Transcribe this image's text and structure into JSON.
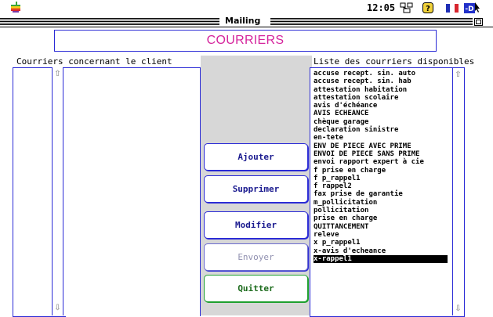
{
  "menubar": {
    "apple_icon": "apple-logo-icon",
    "clock": "12:05",
    "icons": [
      "application-icon",
      "help-icon",
      "flag-icon",
      "keyboard-icon"
    ]
  },
  "window": {
    "title": "Mailing"
  },
  "header": {
    "title": "COURRIERS"
  },
  "left_panel": {
    "label": "Courriers concernant le client",
    "items": []
  },
  "right_panel": {
    "label": "Liste des courriers disponibles",
    "items": [
      "accuse recept. sin. auto",
      "accuse recept. sin. hab",
      "attestation habitation",
      "attestation scolaire",
      "avis d'échéance",
      "AVIS ECHEANCE",
      "chèque garage",
      "declaration sinistre",
      "en-tete",
      "ENV DE PIECE AVEC PRIME",
      "ENVOI DE PIECE SANS PRIME",
      "envoi rapport expert à cie",
      "f prise en charge",
      "f p_rappel1",
      "f rappel2",
      "fax prise de garantie",
      "m_pollicitation",
      "pollicitation",
      "prise en charge",
      "QUITTANCEMENT",
      "releve",
      "x p_rappel1",
      "x-avis d'echeance",
      "x-rappel1"
    ],
    "selected_index": 23
  },
  "buttons": {
    "ajouter": "Ajouter",
    "supprimer": "Supprimer",
    "modifier": "Modifier",
    "envoyer": "Envoyer",
    "quitter": "Quitter"
  },
  "colors": {
    "accent_blue": "#2b2bd6",
    "title_magenta": "#d5249c",
    "quit_green": "#1ea02f",
    "center_gray": "#d7d7d7"
  }
}
